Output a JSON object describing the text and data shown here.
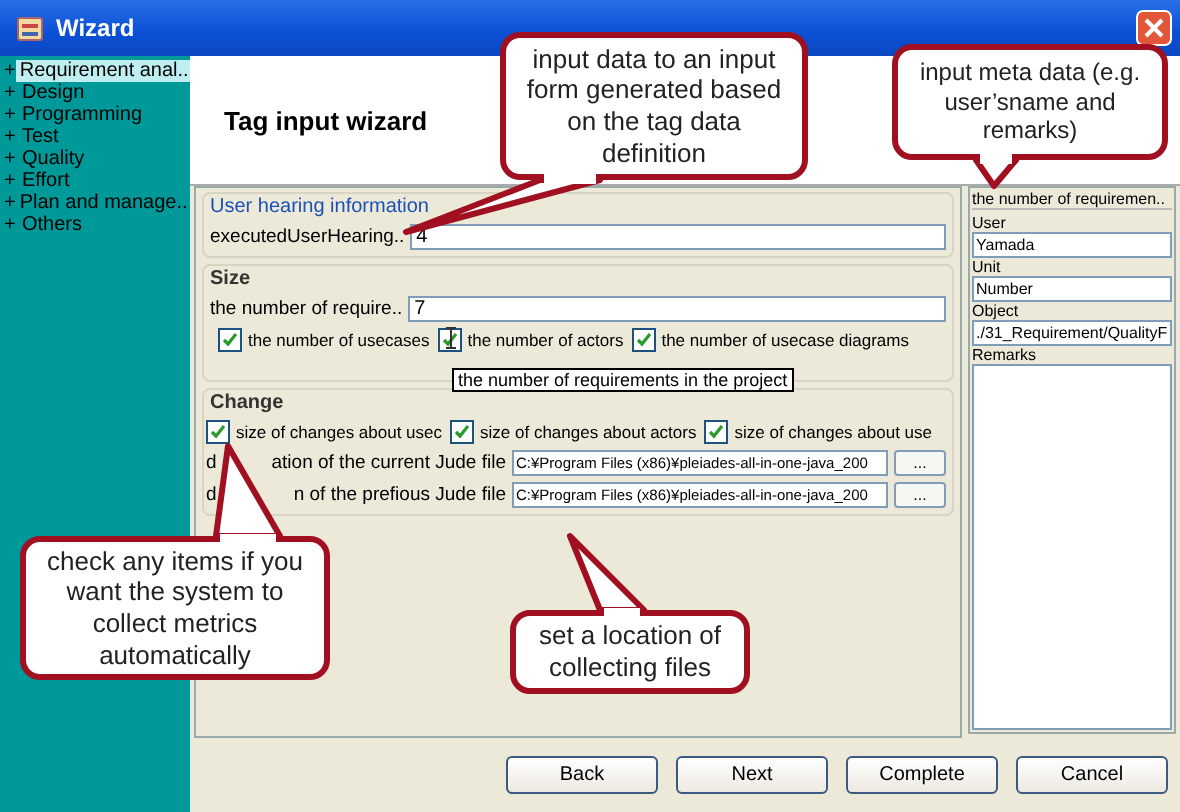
{
  "window": {
    "title": "Wizard"
  },
  "sidebar": {
    "items": [
      {
        "toggle": "+",
        "label": "Requirement anal..",
        "selected": true
      },
      {
        "toggle": "+",
        "label": "Design",
        "selected": false
      },
      {
        "toggle": "+",
        "label": "Programming",
        "selected": false
      },
      {
        "toggle": "+",
        "label": "Test",
        "selected": false
      },
      {
        "toggle": "+",
        "label": "Quality",
        "selected": false
      },
      {
        "toggle": "+",
        "label": "Effort",
        "selected": false
      },
      {
        "toggle": "+",
        "label": "Plan and manage..",
        "selected": false
      },
      {
        "toggle": "+",
        "label": "Others",
        "selected": false
      }
    ]
  },
  "header": {
    "title": "Tag input wizard"
  },
  "form": {
    "user_hearing": {
      "title": "User hearing information",
      "label": "executedUserHearing..",
      "value": "4"
    },
    "size": {
      "title": "Size",
      "label": "the number of require..",
      "value": "7",
      "checkboxes": [
        {
          "label": "the number of usecases",
          "checked": true
        },
        {
          "label": "the number of actors",
          "checked": true
        },
        {
          "label": "the number of usecase diagrams",
          "checked": true
        }
      ],
      "tooltip": "the number of requirements in the project"
    },
    "change": {
      "title": "Change",
      "checkboxes": [
        {
          "label": "size of changes about usec",
          "checked": true
        },
        {
          "label": "size of changes about actors",
          "checked": true
        },
        {
          "label": "size of changes about use",
          "checked": true
        }
      ],
      "files": [
        {
          "label_head": "d",
          "label_tail": "ation of the current Jude file",
          "value": "C:¥Program Files (x86)¥pleiades-all-in-one-java_200",
          "browse": "..."
        },
        {
          "label_head": "d",
          "label_tail": "n of the prefious Jude file",
          "value": "C:¥Program Files (x86)¥pleiades-all-in-one-java_200",
          "browse": "..."
        }
      ]
    }
  },
  "meta": {
    "title": "the number of requiremen..",
    "fields": [
      {
        "label": "User",
        "value": "Yamada"
      },
      {
        "label": "Unit",
        "value": "Number"
      },
      {
        "label": "Object",
        "value": "./31_Requirement/QualityF"
      }
    ],
    "remarks_label": "Remarks"
  },
  "buttons": [
    "Back",
    "Next",
    "Complete",
    "Cancel"
  ],
  "callouts": [
    {
      "text": "input data to an input form generated based on the tag data definition"
    },
    {
      "text": "input meta data (e.g. user’sname and remarks)"
    },
    {
      "text": "check any items if you want the system to collect metrics automatically"
    },
    {
      "text": "set a location of collecting files"
    }
  ]
}
